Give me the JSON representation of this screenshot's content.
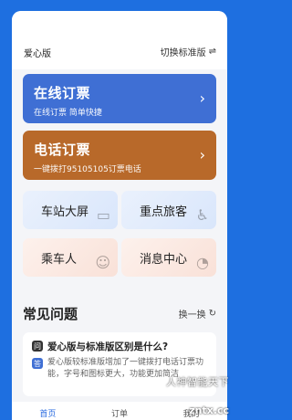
{
  "header": {
    "edition": "爱心版",
    "switch_label": "切换标准版",
    "switch_icon": "⇌"
  },
  "cards": {
    "online": {
      "title": "在线订票",
      "subtitle": "在线订票 简单快捷",
      "chevron": "›",
      "color": "#3f6fd4"
    },
    "phone": {
      "title": "电话订票",
      "subtitle": "一键拨打95105105订票电话",
      "chevron": "›",
      "color": "#b8692a"
    }
  },
  "tiles": {
    "station": "车站大屏",
    "vip": "重点旅客",
    "passenger": "乘车人",
    "message": "消息中心"
  },
  "faq": {
    "title": "常见问题",
    "refresh_label": "换一换",
    "refresh_icon": "↻",
    "q_badge": "问",
    "a_badge": "答",
    "question": "爱心版与标准版区别是什么?",
    "answer": "爱心版较标准版增加了一键拨打电话订票功能，字号和图标更大，功能更加简洁"
  },
  "tabbar": {
    "home": "首页",
    "orders": "订单",
    "mine": "我的"
  },
  "watermark": {
    "text": "人神智能天下",
    "sub": "zntx.cc"
  }
}
